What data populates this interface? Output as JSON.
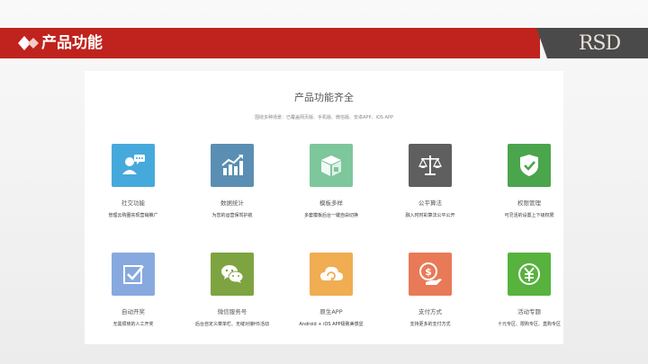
{
  "header": {
    "title": "产品功能",
    "logo_text": "RSD",
    "bar_color": "#c0231d"
  },
  "panel": {
    "title": "产品功能齐全",
    "subtitle": "围绕多种场景：已覆盖网页版、手机版、微信版、安卓APP、iOS APP"
  },
  "features": [
    {
      "name": "社交功能",
      "desc": "管理云购圈实现营销推广",
      "icon": "social-chat-icon",
      "color": "#46a9dc"
    },
    {
      "name": "数据统计",
      "desc": "为您的运营保驾护航",
      "icon": "bar-chart-icon",
      "color": "#5a8fb3"
    },
    {
      "name": "模板多样",
      "desc": "多套模板后台一键自由切换",
      "icon": "template-box-icon",
      "color": "#7ec69b"
    },
    {
      "name": "公平算法",
      "desc": "融入时时彩算法公平公开",
      "icon": "scale-icon",
      "color": "#5f5f5f"
    },
    {
      "name": "权限管理",
      "desc": "可灵活的设置上下级权限",
      "icon": "shield-check-icon",
      "color": "#4aa54c"
    },
    {
      "name": "自动开奖",
      "desc": "无需烦琐的人工开奖",
      "icon": "checkbox-icon",
      "color": "#87a9df"
    },
    {
      "name": "微信服务号",
      "desc": "后台自定义菜单栏、无缝对接H5活动",
      "icon": "wechat-icon",
      "color": "#7da441"
    },
    {
      "name": "原生APP",
      "desc": "Android + iOS APP极致美感显",
      "icon": "cloud-icon",
      "color": "#f0ad52"
    },
    {
      "name": "支付方式",
      "desc": "支持更多的支付方式",
      "icon": "payment-icon",
      "color": "#e87a57"
    },
    {
      "name": "活动专题",
      "desc": "十元专区、限购专区、直购专区",
      "icon": "yuan-coin-icon",
      "color": "#57b23e"
    }
  ]
}
